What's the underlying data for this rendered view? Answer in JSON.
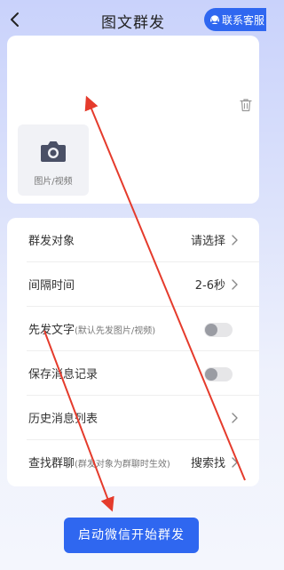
{
  "header": {
    "title": "图文群发",
    "contact_label": "联系客服",
    "back_icon": "chevron-left-icon",
    "contact_icon": "headset-icon"
  },
  "media": {
    "upload_label": "图片/视频",
    "upload_icon": "camera-icon",
    "delete_icon": "trash-icon"
  },
  "settings": {
    "target": {
      "label": "群发对象",
      "value": "请选择"
    },
    "interval": {
      "label": "间隔时间",
      "value": "2-6秒"
    },
    "text_first": {
      "label": "先发文字",
      "note": "(默认先发图片/视频)",
      "enabled": false
    },
    "save_record": {
      "label": "保存消息记录",
      "enabled": false
    },
    "history": {
      "label": "历史消息列表"
    },
    "find_group": {
      "label": "查找群聊",
      "note": "(群发对象为群聊时生效)",
      "value": "搜索找"
    }
  },
  "start_button": {
    "label": "启动微信开始群发"
  },
  "colors": {
    "accent": "#2f67f0",
    "annotation": "#e53b2c",
    "background_top": "#c9d2fb",
    "card": "#ffffff"
  }
}
